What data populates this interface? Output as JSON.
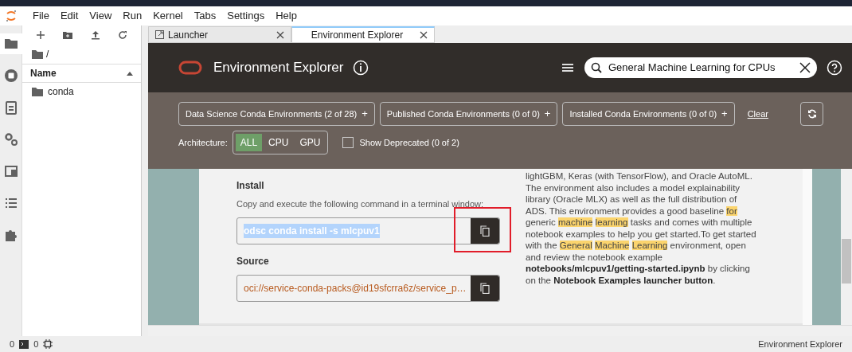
{
  "menu_bar": {
    "items": [
      "File",
      "Edit",
      "View",
      "Run",
      "Kernel",
      "Tabs",
      "Settings",
      "Help"
    ]
  },
  "file_browser": {
    "path": "/",
    "column": "Name",
    "items": [
      {
        "name": "conda",
        "selected": false
      }
    ]
  },
  "side_icons": [
    {
      "kind": "folder",
      "selected": true
    },
    {
      "kind": "stop",
      "selected": false
    },
    {
      "kind": "clipboard",
      "selected": false
    },
    {
      "kind": "gears",
      "selected": false
    },
    {
      "kind": "window",
      "selected": false
    },
    {
      "kind": "list",
      "selected": false
    },
    {
      "kind": "puzzle",
      "selected": false
    }
  ],
  "tabs": [
    {
      "label": "Launcher",
      "selected": false,
      "icon": true
    },
    {
      "label": "Environment Explorer",
      "selected": true,
      "icon": false
    }
  ],
  "header": {
    "title": "Environment Explorer",
    "search": {
      "value": "General Machine Learning for CPUs"
    }
  },
  "filters": [
    {
      "label": "Data Science Conda Environments (2 of 28)",
      "plus": "+"
    },
    {
      "label": "Published Conda Environments (0 of 0)",
      "plus": "+"
    },
    {
      "label": "Installed Conda Environments (0 of 0)",
      "plus": "+"
    }
  ],
  "clear_link": "Clear",
  "architecture": {
    "label": "Architecture:",
    "options": [
      {
        "label": "ALL",
        "selected": true
      },
      {
        "label": "CPU",
        "selected": false
      },
      {
        "label": "GPU",
        "selected": false
      }
    ]
  },
  "show_deprecated": {
    "label": "Show Deprecated (0 of 2)",
    "checked": false
  },
  "install": {
    "heading": "Install",
    "instruction": "Copy and execute the following command in a terminal window:",
    "command": "odsc conda install -s mlcpuv1",
    "command_selected": true,
    "copy_outlined": true
  },
  "source": {
    "heading": "Source",
    "value": "oci://service-conda-packs@id19sfcrra6z/service_p…"
  },
  "description": [
    {
      "kind": "plain",
      "text": "lightGBM, Keras (with TensorFlow), and Oracle AutoML. The environment also includes a model explainability library (Oracle MLX) as well as the full distribution of ADS. This environment provides a good baseline "
    },
    {
      "kind": "highlight",
      "text": "for"
    },
    {
      "kind": "plain",
      "text": " generic "
    },
    {
      "kind": "highlight",
      "text": "machine "
    },
    {
      "kind": "highlight",
      "text": "learning"
    },
    {
      "kind": "plain",
      "text": " tasks and comes with multiple notebook examples to help you get started.To get started with the "
    },
    {
      "kind": "highlight",
      "text": "General "
    },
    {
      "kind": "highlight",
      "text": "Machine "
    },
    {
      "kind": "highlight",
      "text": "Learning"
    },
    {
      "kind": "plain",
      "text": " environment, open and review the notebook example "
    },
    {
      "kind": "bold",
      "text": "notebooks/mlcpuv1/getting-started.ipynb"
    },
    {
      "kind": "plain",
      "text": " by clicking on the "
    },
    {
      "kind": "bold",
      "text": "Notebook Examples launcher button"
    },
    {
      "kind": "plain",
      "text": "."
    }
  ],
  "status_bar": {
    "left": [
      {
        "kind": "count",
        "text": "0"
      },
      {
        "kind": "terminal-count",
        "text": "0"
      }
    ],
    "right": "Environment Explorer"
  }
}
